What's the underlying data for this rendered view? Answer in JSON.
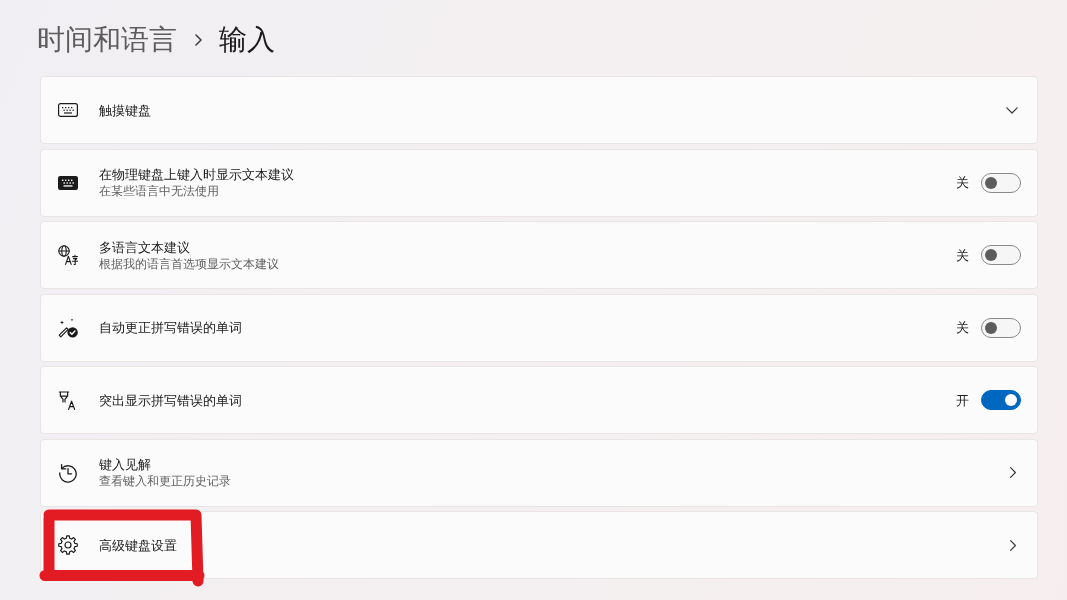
{
  "header": {
    "breadcrumb": [
      {
        "label": "时间和语言",
        "current": false
      },
      {
        "label": "输入",
        "current": true
      }
    ]
  },
  "settings": [
    {
      "kind": "expand",
      "title": "触摸键盘",
      "expanded": false,
      "highlighted": false
    },
    {
      "kind": "toggle",
      "title": "在物理键盘上键入时显示文本建议",
      "description": "在某些语言中无法使用",
      "on": false,
      "state_label": "关",
      "highlighted": false
    },
    {
      "kind": "toggle",
      "title": "多语言文本建议",
      "description": "根据我的语言首选项显示文本建议",
      "on": false,
      "state_label": "关",
      "highlighted": false
    },
    {
      "kind": "toggle",
      "title": "自动更正拼写错误的单词",
      "on": false,
      "state_label": "关",
      "highlighted": false
    },
    {
      "kind": "toggle",
      "title": "突出显示拼写错误的单词",
      "on": true,
      "state_label": "开",
      "highlighted": false
    },
    {
      "kind": "link",
      "title": "键入见解",
      "description": "查看键入和更正历史记录",
      "highlighted": false
    },
    {
      "kind": "link",
      "title": "高级键盘设置",
      "highlighted": true
    }
  ]
}
